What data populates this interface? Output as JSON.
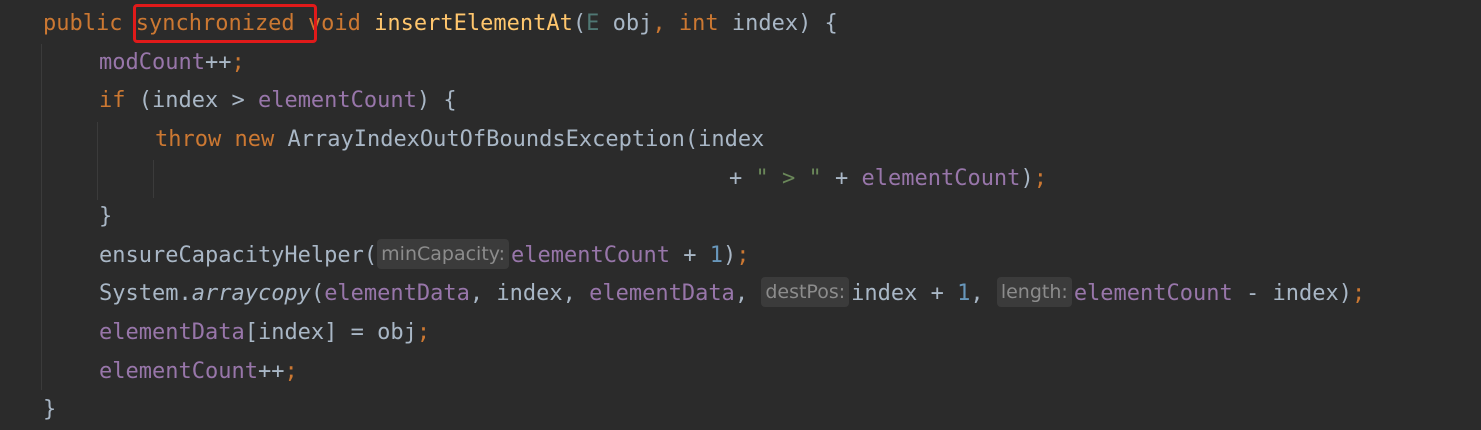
{
  "code": {
    "l1": {
      "public": "public",
      "synchronized": "synchronized",
      "void": "void",
      "method": "insertElementAt",
      "open_paren": "(",
      "type_e": "E",
      "obj": " obj",
      "comma": ",",
      "int": "int",
      "rest": " index) {"
    },
    "l2": {
      "field": "modCount",
      "op": "++",
      "semi": ";"
    },
    "l3": {
      "if": "if",
      "mid": " (index > ",
      "field": "elementCount",
      "end": ") {"
    },
    "l4": {
      "throw": "throw",
      "new": "new",
      "rest": " ArrayIndexOutOfBoundsException(index"
    },
    "l5": {
      "plus1": "+ ",
      "str": "\" > \"",
      "plus2": " + ",
      "field": "elementCount",
      "close": ")",
      "semi": ";"
    },
    "l6": {
      "brace": "}"
    },
    "l7": {
      "call": "ensureCapacityHelper(",
      "hint": "minCapacity:",
      "field": "elementCount",
      "plus": " + ",
      "num": "1",
      "close": ")",
      "semi": ";"
    },
    "l8": {
      "sys": "System.",
      "method": "arraycopy",
      "open": "(",
      "field1": "elementData",
      "sep1": ", index, ",
      "field2": "elementData",
      "comma2": ", ",
      "hint1": "destPos:",
      "arg": "index + ",
      "num": "1",
      "comma3": ", ",
      "hint2": "length:",
      "field3": "elementCount",
      "minus": " - index)",
      "semi": ";"
    },
    "l9": {
      "field": "elementData",
      "rest": "[index] = obj",
      "semi": ";"
    },
    "l10": {
      "field": "elementCount",
      "op": "++",
      "semi": ";"
    },
    "l11": {
      "brace": "}"
    }
  }
}
